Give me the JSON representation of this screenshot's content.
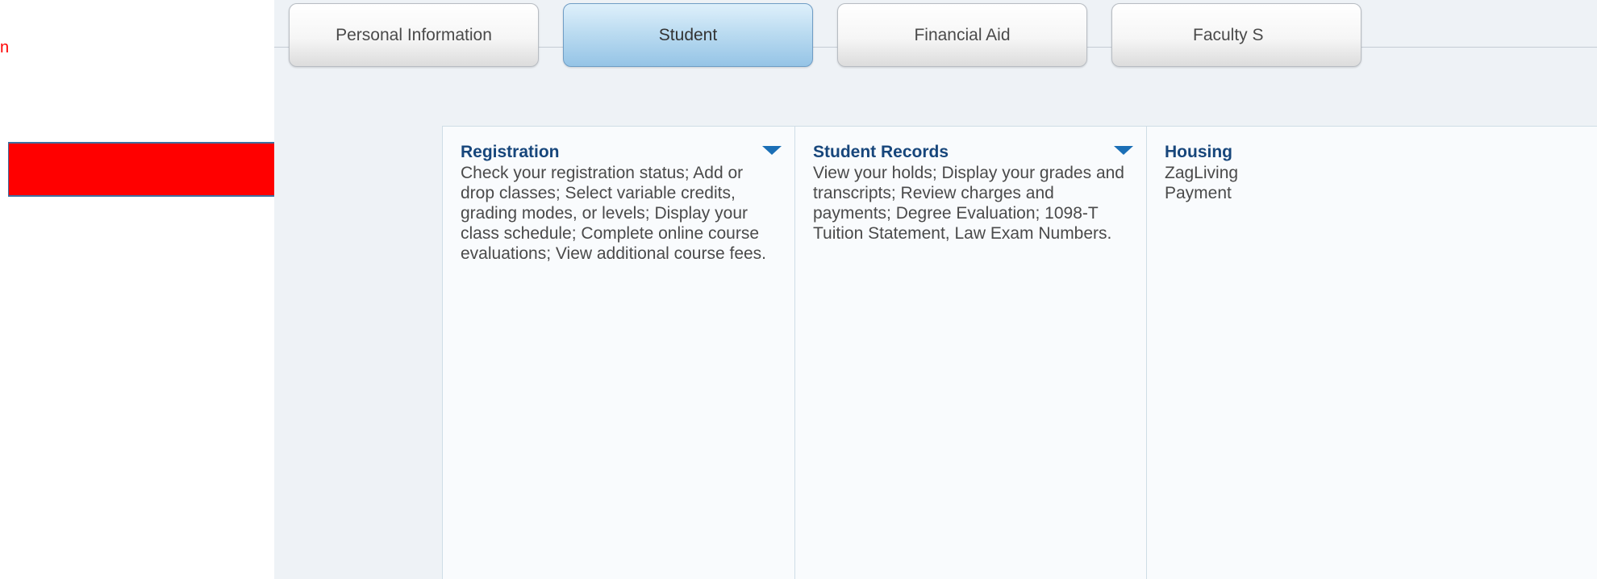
{
  "stray_text": "n",
  "colors": {
    "arrow": "#ff0000",
    "title": "#17467b",
    "accent": "#1b6fb6"
  },
  "tabs": [
    {
      "label": "Personal Information",
      "active": false
    },
    {
      "label": "Student",
      "active": true
    },
    {
      "label": "Financial Aid",
      "active": false
    },
    {
      "label": "Faculty S",
      "active": false
    }
  ],
  "cards": [
    {
      "title": "Registration",
      "description": "Check your registration status; Add or drop classes; Select variable credits, grading modes, or levels; Display your class schedule; Complete online course evaluations; View additional course fees.",
      "icon": "caret-down-icon"
    },
    {
      "title": "Student Records",
      "description": "View your holds; Display your grades and transcripts; Review charges and payments; Degree Evaluation; 1098-T Tuition Statement, Law Exam Numbers.",
      "icon": "caret-down-icon"
    },
    {
      "title": "Housing",
      "description_lines": [
        "ZagLiving",
        "Payment"
      ]
    }
  ],
  "annotation": {
    "icon": "red-arrow-icon"
  }
}
